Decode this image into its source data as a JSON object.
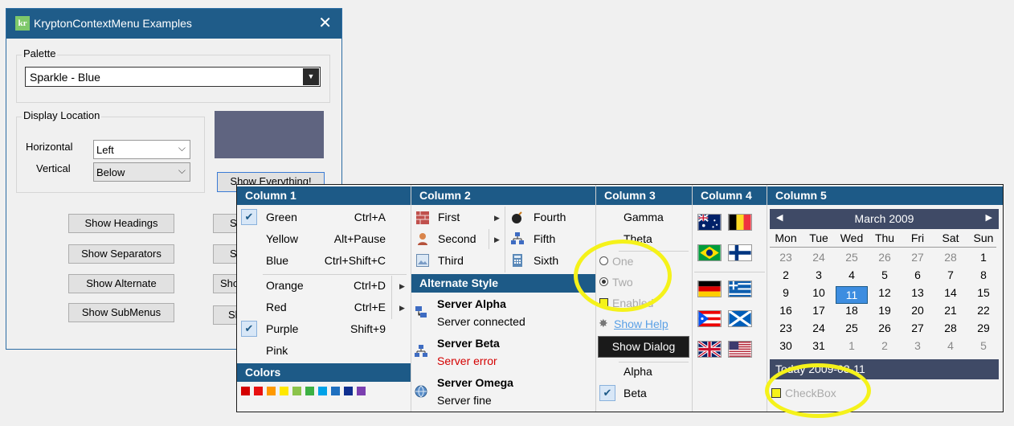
{
  "window": {
    "title": "KryptonContextMenu Examples",
    "icon_text": "kr",
    "close_glyph": "✕"
  },
  "palette": {
    "group_title": "Palette",
    "value": "Sparkle - Blue"
  },
  "display_location": {
    "group_title": "Display Location",
    "horizontal_label": "Horizontal",
    "horizontal_value": "Left",
    "vertical_label": "Vertical",
    "vertical_value": "Below"
  },
  "buttons": {
    "show_everything": "Show Everything!",
    "show_headings": "Show Headings",
    "show_separators": "Show Separators",
    "show_alternate": "Show Alternate",
    "show_submenus": "Show SubMenus",
    "right_1": "S",
    "right_2": "S",
    "right_3": "Sho",
    "right_4": "Sh"
  },
  "menu": {
    "col1": {
      "heading": "Column 1",
      "items": [
        {
          "label": "Green",
          "shortcut": "Ctrl+A"
        },
        {
          "label": "Yellow",
          "shortcut": "Alt+Pause"
        },
        {
          "label": "Blue",
          "shortcut": "Ctrl+Shift+C"
        },
        {
          "label": "Orange",
          "shortcut": "Ctrl+D"
        },
        {
          "label": "Red",
          "shortcut": "Ctrl+E"
        },
        {
          "label": "Purple",
          "shortcut": "Shift+9"
        },
        {
          "label": "Pink",
          "shortcut": ""
        }
      ],
      "colors_heading": "Colors",
      "colors": [
        "#d40000",
        "#e81010",
        "#ff9900",
        "#ffe800",
        "#8bc34a",
        "#3cb043",
        "#00a2e8",
        "#1e6fbf",
        "#0f2f8f",
        "#7b3fb0"
      ]
    },
    "col2": {
      "heading": "Column 2",
      "items_a": [
        {
          "label": "First"
        },
        {
          "label": "Second"
        },
        {
          "label": "Third"
        }
      ],
      "items_b": [
        {
          "label": "Fourth"
        },
        {
          "label": "Fifth"
        },
        {
          "label": "Sixth"
        }
      ],
      "alt_heading": "Alternate Style",
      "servers": [
        {
          "name": "Server Alpha",
          "status": "Server connected",
          "status_color": "#000000"
        },
        {
          "name": "Server Beta",
          "status": "Server error",
          "status_color": "#d40000"
        },
        {
          "name": "Server Omega",
          "status": "Server fine",
          "status_color": "#000000"
        }
      ]
    },
    "col3": {
      "heading": "Column 3",
      "items": [
        "Gamma",
        "Theta"
      ],
      "radio_one": "One",
      "radio_two": "Two",
      "checkbox": "Enabled",
      "link": "Show Help",
      "dialog_button": "Show Dialog",
      "items_b": [
        "Alpha",
        "Beta"
      ]
    },
    "col4": {
      "heading": "Column 4",
      "flags": [
        "australia-flag",
        "belgium-flag",
        "brazil-flag",
        "finland-flag",
        "germany-flag",
        "greece-flag",
        "puerto-rico-flag",
        "scotland-flag",
        "uk-flag",
        "usa-flag"
      ]
    },
    "col5": {
      "heading": "Column 5",
      "month": "March 2009",
      "days_of_week": [
        "Mon",
        "Tue",
        "Wed",
        "Thu",
        "Fri",
        "Sat",
        "Sun"
      ],
      "weeks": [
        [
          "23",
          "24",
          "25",
          "26",
          "27",
          "28",
          "1"
        ],
        [
          "2",
          "3",
          "4",
          "5",
          "6",
          "7",
          "8"
        ],
        [
          "9",
          "10",
          "11",
          "12",
          "13",
          "14",
          "15"
        ],
        [
          "16",
          "17",
          "18",
          "19",
          "20",
          "21",
          "22"
        ],
        [
          "23",
          "24",
          "25",
          "26",
          "27",
          "28",
          "29"
        ],
        [
          "30",
          "31",
          "1",
          "2",
          "3",
          "4",
          "5"
        ]
      ],
      "selected_day": "11",
      "today_label": "Today 2009-03-11",
      "checkbox": "CheckBox"
    }
  }
}
